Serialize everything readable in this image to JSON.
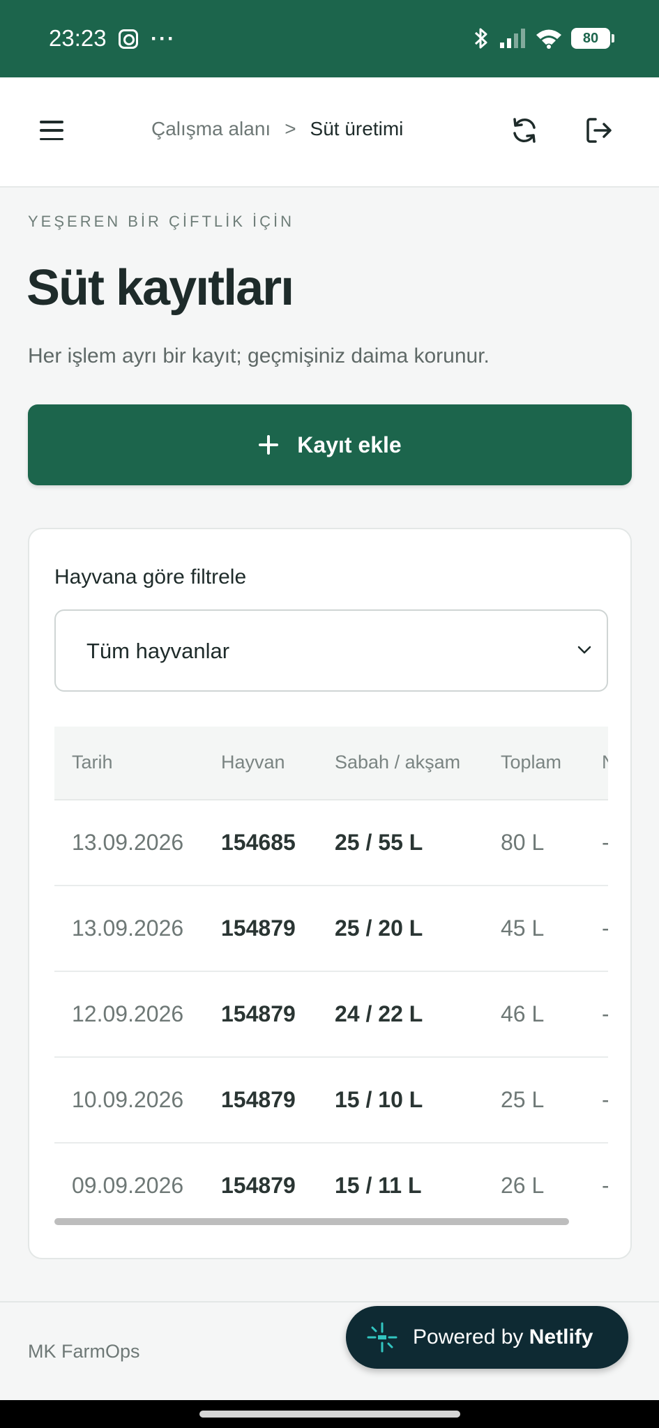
{
  "status_bar": {
    "time": "23:23",
    "dots": "···",
    "battery": "80"
  },
  "header": {
    "breadcrumb_parent": "Çalışma alanı",
    "breadcrumb_separator": ">",
    "breadcrumb_current": "Süt üretimi"
  },
  "page": {
    "eyebrow": "YEŞEREN BİR ÇİFTLİK İÇİN",
    "title": "Süt kayıtları",
    "subtitle": "Her işlem ayrı bir kayıt; geçmişiniz daima korunur.",
    "add_button_label": "Kayıt ekle"
  },
  "filter": {
    "label": "Hayvana göre filtrele",
    "selected": "Tüm hayvanlar"
  },
  "table": {
    "columns": [
      "Tarih",
      "Hayvan",
      "Sabah / akşam",
      "Toplam",
      "N"
    ],
    "rows": [
      {
        "date": "13.09.2026",
        "animal": "154685",
        "morning_evening": "25 / 55 L",
        "total": "80 L",
        "note": "-"
      },
      {
        "date": "13.09.2026",
        "animal": "154879",
        "morning_evening": "25 / 20 L",
        "total": "45 L",
        "note": "-"
      },
      {
        "date": "12.09.2026",
        "animal": "154879",
        "morning_evening": "24 / 22 L",
        "total": "46 L",
        "note": "-"
      },
      {
        "date": "10.09.2026",
        "animal": "154879",
        "morning_evening": "15 / 10 L",
        "total": "25 L",
        "note": "-"
      },
      {
        "date": "09.09.2026",
        "animal": "154879",
        "morning_evening": "15 / 11 L",
        "total": "26 L",
        "note": "-"
      }
    ]
  },
  "footer": {
    "brand": "MK FarmOps",
    "badge_prefix": "Powered by",
    "badge_brand": "Netlify"
  },
  "colors": {
    "primary": "#1c654c",
    "badge_bg": "#0e2a33",
    "netlify_accent": "#32c5c0"
  }
}
